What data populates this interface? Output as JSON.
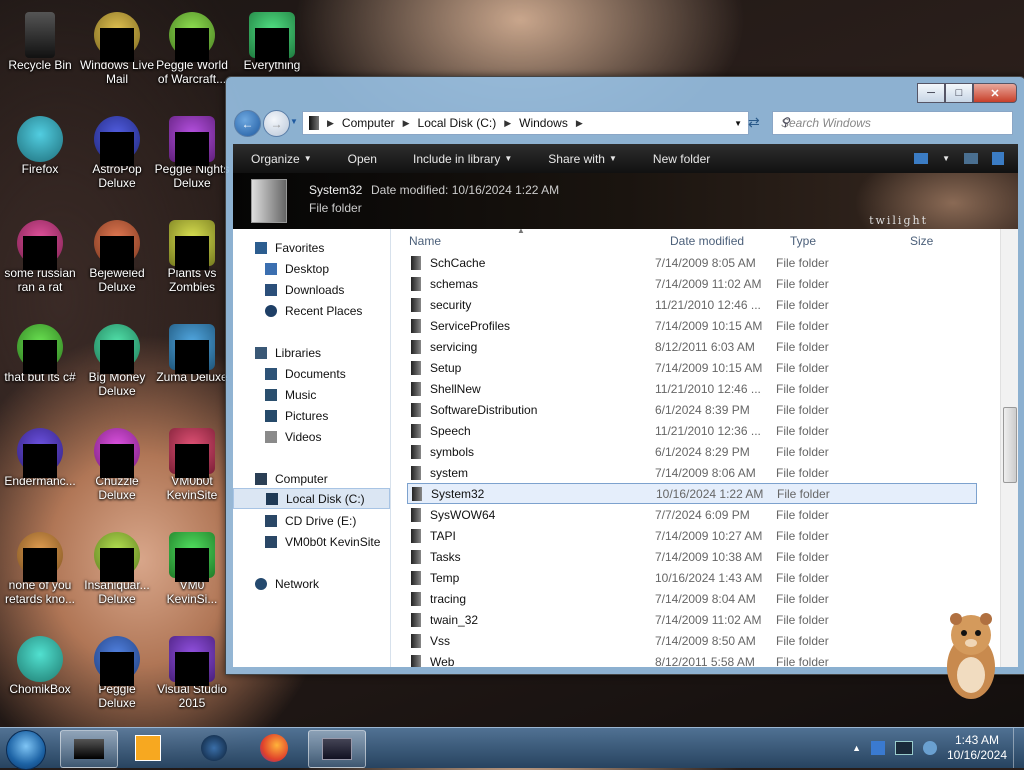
{
  "desktop": {
    "icons": [
      {
        "label": "Recycle Bin",
        "icon": "recycle-bin-icon"
      },
      {
        "label": "Windows Live Mail",
        "icon": "mail-icon"
      },
      {
        "label": "Peggle World of Warcraft...",
        "icon": "peggle-icon"
      },
      {
        "label": "Everything",
        "icon": "search-app-icon"
      },
      {
        "label": "Firefox",
        "icon": "firefox-icon"
      },
      {
        "label": "AstroPop Deluxe",
        "icon": "astropop-icon"
      },
      {
        "label": "Peggle Nights Deluxe",
        "icon": "peggle-icon"
      },
      {
        "label": "some russian ran a rat",
        "icon": "app-icon"
      },
      {
        "label": "Bejeweled Deluxe",
        "icon": "bejeweled-icon"
      },
      {
        "label": "Plants vs Zombies",
        "icon": "pvz-icon"
      },
      {
        "label": "that but its c#",
        "icon": "app-icon"
      },
      {
        "label": "Big Money Deluxe",
        "icon": "bigmoney-icon"
      },
      {
        "label": "Zuma Deluxe",
        "icon": "zuma-icon"
      },
      {
        "label": "Endermanc...",
        "icon": "app-icon"
      },
      {
        "label": "Chuzzle Deluxe",
        "icon": "chuzzle-icon"
      },
      {
        "label": "VM0b0t KevinSite",
        "icon": "folder-icon"
      },
      {
        "label": "none of you retards kno...",
        "icon": "app-icon"
      },
      {
        "label": "Insaniquar... Deluxe",
        "icon": "insaniquarium-icon"
      },
      {
        "label": "VM0 KevinSi...",
        "icon": "folder-icon"
      },
      {
        "label": "ChomikBox",
        "icon": "chomikbox-icon"
      },
      {
        "label": "Peggle Deluxe",
        "icon": "peggle-icon"
      },
      {
        "label": "Visual Studio 2015",
        "icon": "visual-studio-icon"
      }
    ]
  },
  "window": {
    "breadcrumb": [
      "Computer",
      "Local Disk (C:)",
      "Windows"
    ],
    "search_placeholder": "Search Windows",
    "toolbar": {
      "organize": "Organize",
      "open": "Open",
      "include": "Include in library",
      "share": "Share with",
      "newfolder": "New folder"
    },
    "details": {
      "name": "System32",
      "modified_label": "Date modified:",
      "modified": "10/16/2024 1:22 AM",
      "type": "File folder",
      "brand": "twilight"
    },
    "nav": {
      "favorites": "Favorites",
      "desktop": "Desktop",
      "downloads": "Downloads",
      "recent": "Recent Places",
      "libraries": "Libraries",
      "documents": "Documents",
      "music": "Music",
      "pictures": "Pictures",
      "videos": "Videos",
      "computer": "Computer",
      "localdisk": "Local Disk (C:)",
      "cddrive": "CD Drive (E:)",
      "vm": "VM0b0t KevinSite",
      "network": "Network"
    },
    "columns": {
      "name": "Name",
      "date": "Date modified",
      "type": "Type",
      "size": "Size"
    },
    "rows": [
      {
        "name": "SchCache",
        "date": "7/14/2009 8:05 AM",
        "type": "File folder"
      },
      {
        "name": "schemas",
        "date": "7/14/2009 11:02 AM",
        "type": "File folder"
      },
      {
        "name": "security",
        "date": "11/21/2010 12:46 ...",
        "type": "File folder"
      },
      {
        "name": "ServiceProfiles",
        "date": "7/14/2009 10:15 AM",
        "type": "File folder"
      },
      {
        "name": "servicing",
        "date": "8/12/2011 6:03 AM",
        "type": "File folder"
      },
      {
        "name": "Setup",
        "date": "7/14/2009 10:15 AM",
        "type": "File folder"
      },
      {
        "name": "ShellNew",
        "date": "11/21/2010 12:46 ...",
        "type": "File folder"
      },
      {
        "name": "SoftwareDistribution",
        "date": "6/1/2024 8:39 PM",
        "type": "File folder"
      },
      {
        "name": "Speech",
        "date": "11/21/2010 12:36 ...",
        "type": "File folder"
      },
      {
        "name": "symbols",
        "date": "6/1/2024 8:29 PM",
        "type": "File folder"
      },
      {
        "name": "system",
        "date": "7/14/2009 8:06 AM",
        "type": "File folder"
      },
      {
        "name": "System32",
        "date": "10/16/2024 1:22 AM",
        "type": "File folder"
      },
      {
        "name": "SysWOW64",
        "date": "7/7/2024 6:09 PM",
        "type": "File folder"
      },
      {
        "name": "TAPI",
        "date": "7/14/2009 10:27 AM",
        "type": "File folder"
      },
      {
        "name": "Tasks",
        "date": "7/14/2009 10:38 AM",
        "type": "File folder"
      },
      {
        "name": "Temp",
        "date": "10/16/2024 1:43 AM",
        "type": "File folder"
      },
      {
        "name": "tracing",
        "date": "7/14/2009 8:04 AM",
        "type": "File folder"
      },
      {
        "name": "twain_32",
        "date": "7/14/2009 11:02 AM",
        "type": "File folder"
      },
      {
        "name": "Vss",
        "date": "7/14/2009 8:50 AM",
        "type": "File folder"
      },
      {
        "name": "Web",
        "date": "8/12/2011 5:58 AM",
        "type": "File folder"
      }
    ]
  },
  "taskbar": {
    "time": "1:43 AM",
    "date": "10/16/2024"
  }
}
